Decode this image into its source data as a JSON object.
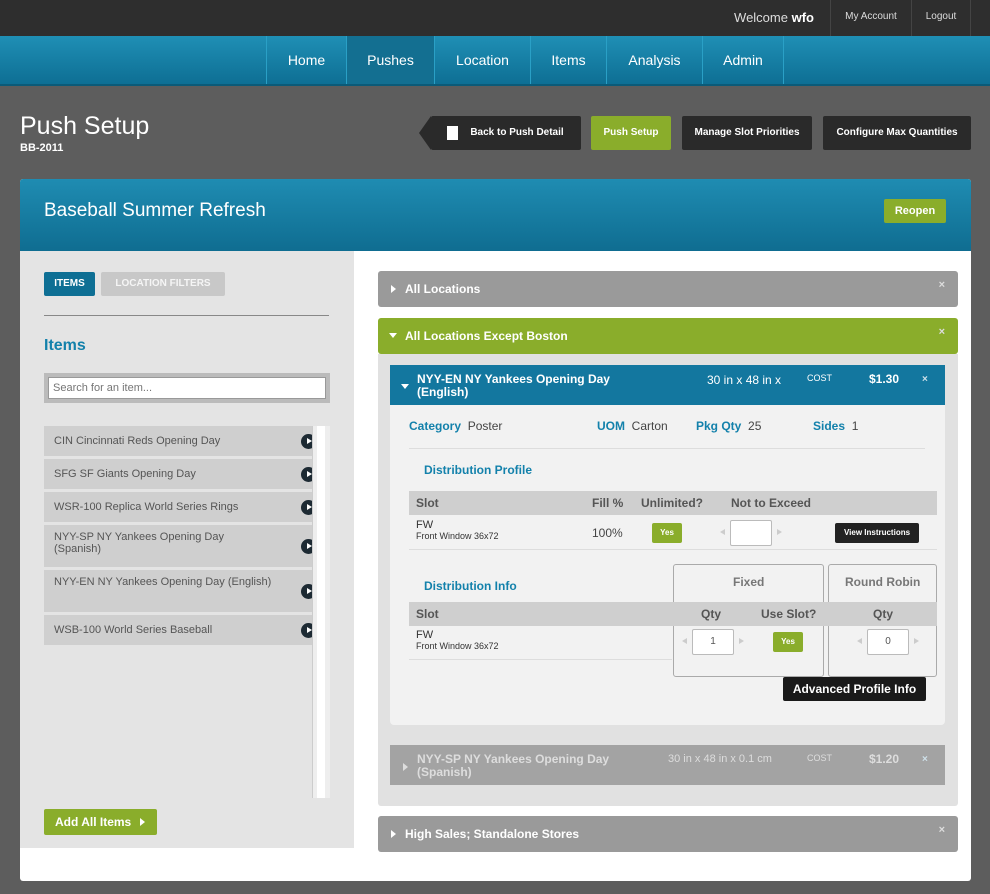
{
  "topbar": {
    "welcome_prefix": "Welcome",
    "username": "wfo",
    "my_account": "My Account",
    "logout": "Logout"
  },
  "nav": {
    "items": [
      "Home",
      "Pushes",
      "Location",
      "Items",
      "Analysis",
      "Admin"
    ],
    "active": "Pushes"
  },
  "page": {
    "title": "Push Setup",
    "code": "BB-2011",
    "buttons": {
      "back": "Back to Push Detail",
      "push_setup": "Push Setup",
      "slot_priorities": "Manage Slot Priorities",
      "max_quantities": "Configure Max Quantities"
    }
  },
  "panel": {
    "title": "Baseball Summer Refresh",
    "reopen": "Reopen"
  },
  "sidebar": {
    "tabs": [
      "ITEMS",
      "LOCATION FILTERS"
    ],
    "heading": "Items",
    "search_placeholder": "Search for an item...",
    "items": [
      "CIN Cincinnati Reds Opening Day",
      "SFG SF Giants Opening Day",
      "WSR-100 Replica World Series Rings",
      "NYY-SP NY Yankees Opening Day (Spanish)",
      "NYY-EN NY Yankees Opening Day (English)",
      "WSB-100 World Series Baseball"
    ],
    "add_all": "Add All Items"
  },
  "groups": {
    "all_locations": "All Locations",
    "except_boston": "All Locations Except Boston",
    "high_sales": "High Sales; Standalone Stores",
    "close": "×"
  },
  "item_en": {
    "name": "NYY-EN NY Yankees Opening Day (English)",
    "size": "30 in x 48 in x",
    "cost_label": "COST",
    "price": "$1.30",
    "close": "×",
    "attrs": {
      "category_label": "Category",
      "category": "Poster",
      "uom_label": "UOM",
      "uom": "Carton",
      "pkg_label": "Pkg Qty",
      "pkg": "25",
      "sides_label": "Sides",
      "sides": "1"
    },
    "profile": {
      "heading": "Distribution Profile",
      "headers": {
        "slot": "Slot",
        "fill": "Fill %",
        "unlimited": "Unlimited?",
        "nte": "Not to Exceed"
      },
      "row": {
        "slot": "FW",
        "slot_desc": "Front Window 36x72",
        "fill": "100%",
        "unlimited": "Yes",
        "view": "View Instructions"
      }
    },
    "info": {
      "heading": "Distribution Info",
      "fixed": "Fixed",
      "round_robin": "Round Robin",
      "headers": {
        "slot": "Slot",
        "qty": "Qty",
        "use_slot": "Use Slot?",
        "rr_qty": "Qty"
      },
      "row": {
        "slot": "FW",
        "slot_desc": "Front Window 36x72",
        "qty": "1",
        "use_slot": "Yes",
        "rr_qty": "0"
      }
    },
    "advanced": "Advanced Profile Info"
  },
  "item_sp": {
    "name": "NYY-SP NY Yankees Opening Day (Spanish)",
    "size": "30 in x 48 in x 0.1 cm",
    "cost_label": "COST",
    "price": "$1.20",
    "close": "×"
  }
}
